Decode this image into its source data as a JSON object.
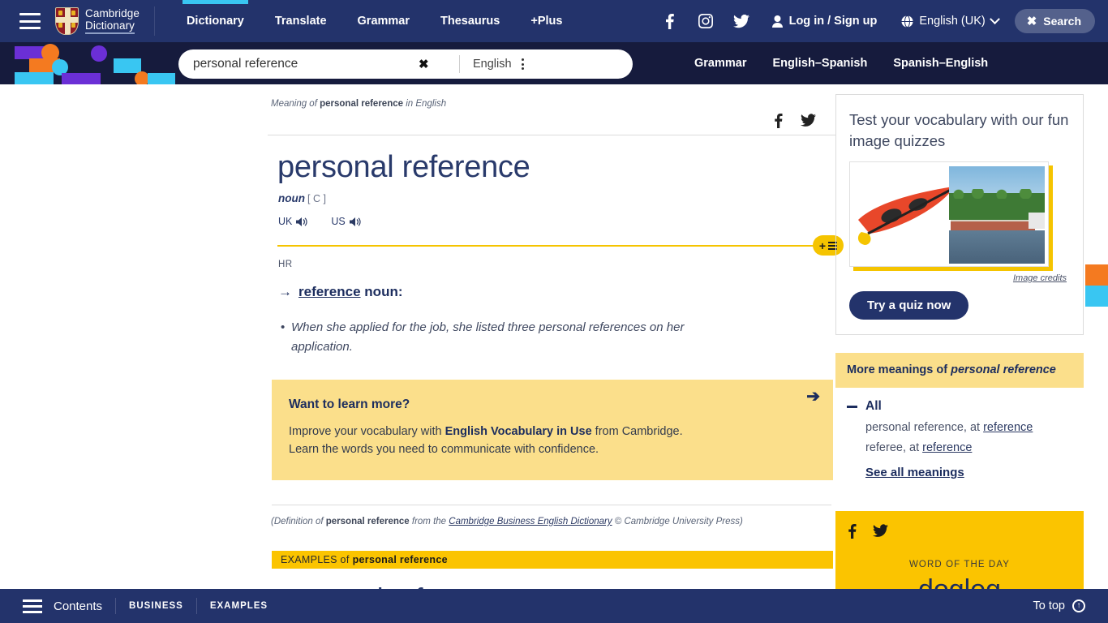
{
  "topnav": {
    "menu_label": "Menu",
    "brand_line1": "Cambridge",
    "brand_line2": "Dictionary",
    "links": [
      {
        "label": "Dictionary",
        "active": true
      },
      {
        "label": "Translate",
        "active": false
      },
      {
        "label": "Grammar",
        "active": false
      },
      {
        "label": "Thesaurus",
        "active": false
      },
      {
        "label": "+Plus",
        "active": false
      }
    ],
    "login_label": "Log in / Sign up",
    "language_label": "English (UK)",
    "search_toggle_label": "Search"
  },
  "searchbar": {
    "query": "personal reference",
    "placeholder": "Search",
    "clear_label": "✖",
    "dictionary_language": "English",
    "quicklinks": [
      "Grammar",
      "English–Spanish",
      "Spanish–English"
    ]
  },
  "entry": {
    "meaning_prefix": "Meaning of ",
    "meaning_word": "personal reference",
    "meaning_suffix": " in English",
    "headword": "personal reference",
    "part_of_speech": "noun",
    "countability": "[ C ]",
    "pronunciations": [
      {
        "region": "UK"
      },
      {
        "region": "US"
      }
    ],
    "domain_label": "HR",
    "xref_arrow": "→",
    "xref_word": "reference",
    "xref_pos": "noun",
    "xref_colon": ":",
    "example": "When she applied for the job, she listed three personal references on her application.",
    "promo": {
      "heading": "Want to learn more?",
      "line1_a": "Improve your vocabulary with ",
      "line1_bold": "English Vocabulary in Use",
      "line1_b": " from Cambridge.",
      "line2": "Learn the words you need to communicate with confidence.",
      "arrow": "➔"
    },
    "source": {
      "prefix": "(Definition of ",
      "word": "personal reference",
      "middle": " from the ",
      "link": "Cambridge Business English Dictionary",
      "suffix": " © Cambridge University Press)"
    },
    "examples_bar_prefix": "EXAMPLES of ",
    "examples_bar_word": "personal reference",
    "examples_word": "personal reference"
  },
  "sidebar": {
    "quiz": {
      "heading": "Test your vocabulary with our fun image quizzes",
      "image_credits": "Image credits",
      "button": "Try a quiz now"
    },
    "more": {
      "heading_prefix": "More meanings of ",
      "heading_word": "personal reference",
      "all_label": "All",
      "items": [
        {
          "text": "personal reference, at ",
          "link": "reference"
        },
        {
          "text": "referee, at ",
          "link": "reference"
        }
      ],
      "see_all": "See all meanings"
    },
    "wotd": {
      "label": "WORD OF THE DAY",
      "word": "dogleg"
    }
  },
  "bottombar": {
    "contents_label": "Contents",
    "chips": [
      "BUSINESS",
      "EXAMPLES"
    ],
    "to_top_label": "To top"
  },
  "colors": {
    "navy": "#23336b",
    "dark_navy": "#161b3d",
    "yellow": "#f5c400",
    "gold": "#fbc400",
    "light_yellow": "#fbdf8b",
    "cyan": "#39c6f2",
    "orange": "#f47a20",
    "purple": "#6b2fd6"
  }
}
